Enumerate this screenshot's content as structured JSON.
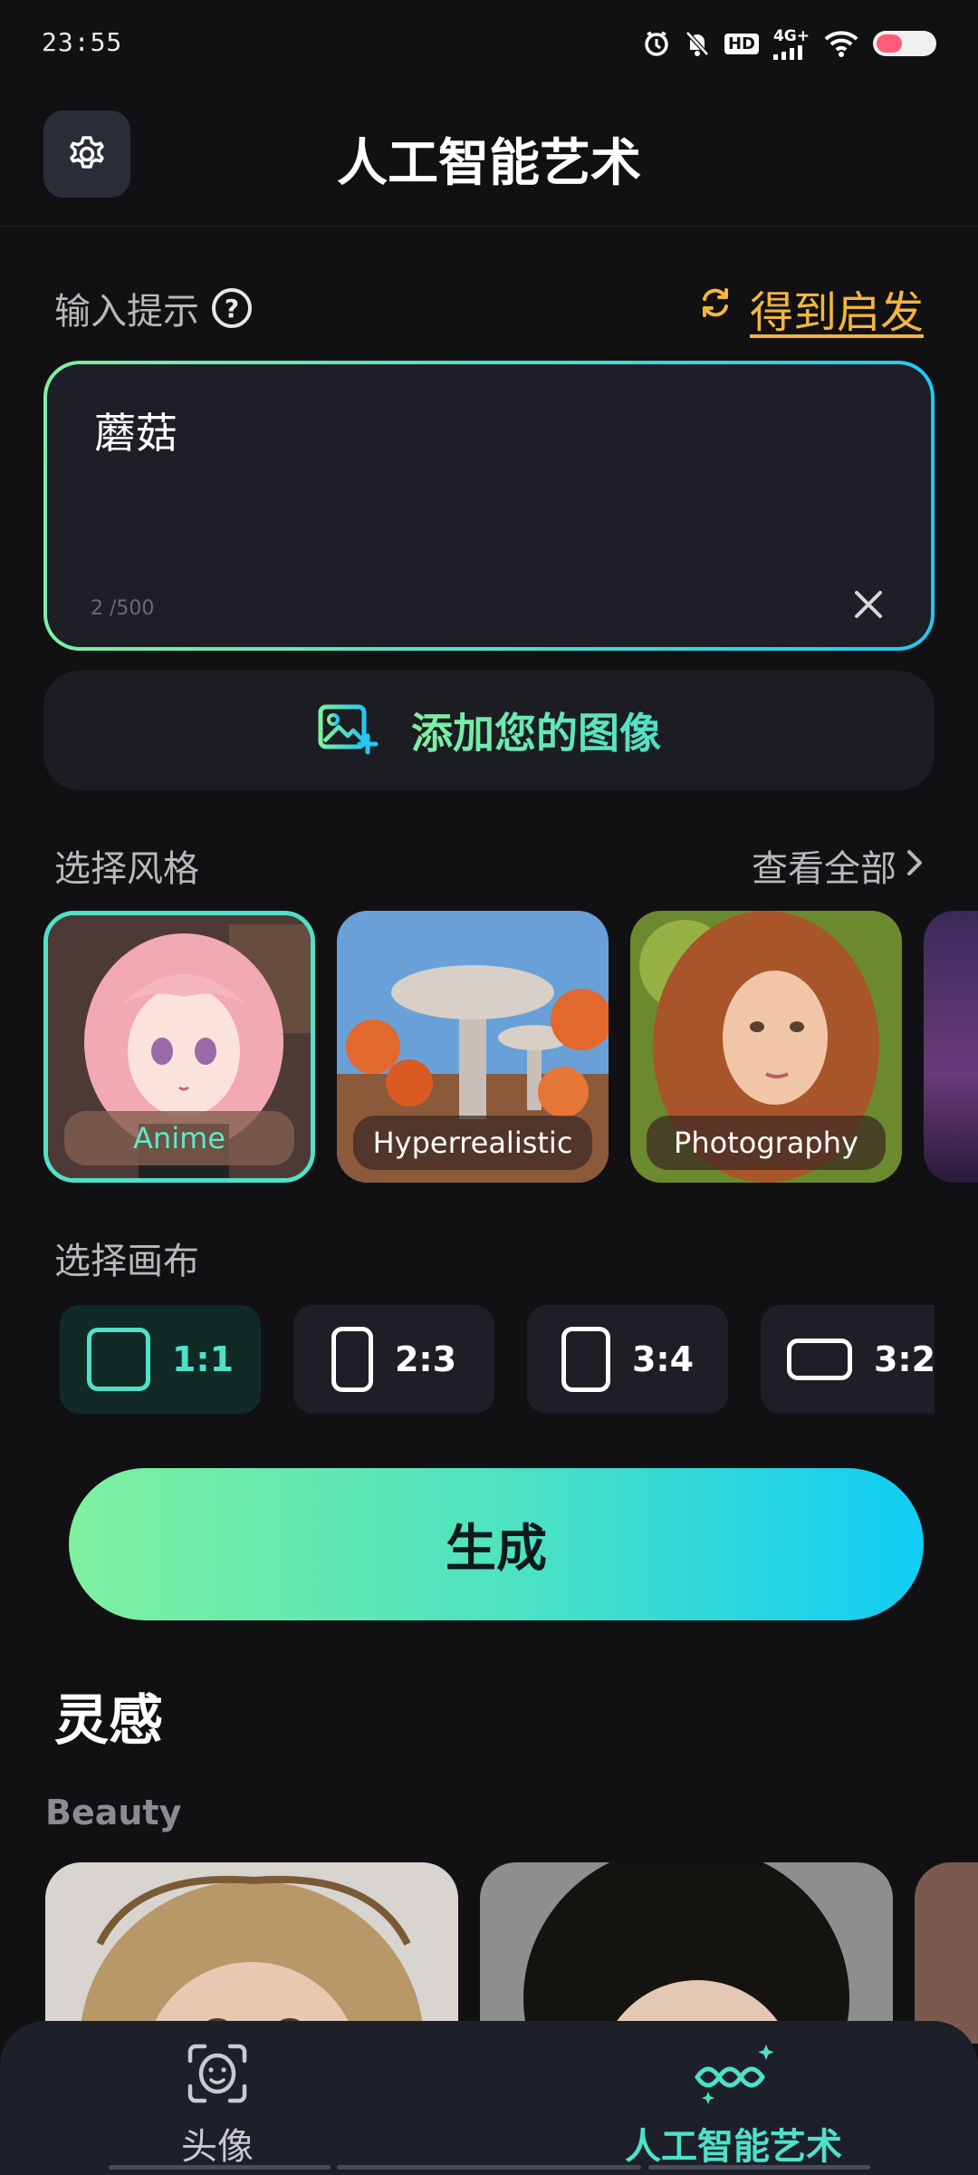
{
  "status_bar": {
    "time": "23:55",
    "network": "4G+",
    "hd": "HD"
  },
  "header": {
    "title": "人工智能艺术"
  },
  "prompt": {
    "label": "输入提示",
    "inspire_label": "得到启发",
    "value": "蘑菇",
    "char_count": "2 /500"
  },
  "add_image": {
    "label": "添加您的图像"
  },
  "styles": {
    "title": "选择风格",
    "view_all": "查看全部",
    "items": [
      {
        "label": "Anime",
        "selected": true
      },
      {
        "label": "Hyperrealistic",
        "selected": false
      },
      {
        "label": "Photography",
        "selected": false
      }
    ]
  },
  "canvas": {
    "title": "选择画布",
    "ratios": [
      {
        "label": "1:1",
        "selected": true
      },
      {
        "label": "2:3",
        "selected": false
      },
      {
        "label": "3:4",
        "selected": false
      },
      {
        "label": "3:2",
        "selected": false
      }
    ]
  },
  "generate": {
    "label": "生成"
  },
  "inspiration": {
    "title": "灵感",
    "category": "Beauty"
  },
  "bottom_nav": {
    "items": [
      {
        "label": "头像",
        "active": false
      },
      {
        "label": "人工智能艺术",
        "active": true
      }
    ]
  },
  "colors": {
    "accent": "#4fe0c8",
    "inspire": "#f3b53c",
    "background": "#111113"
  }
}
